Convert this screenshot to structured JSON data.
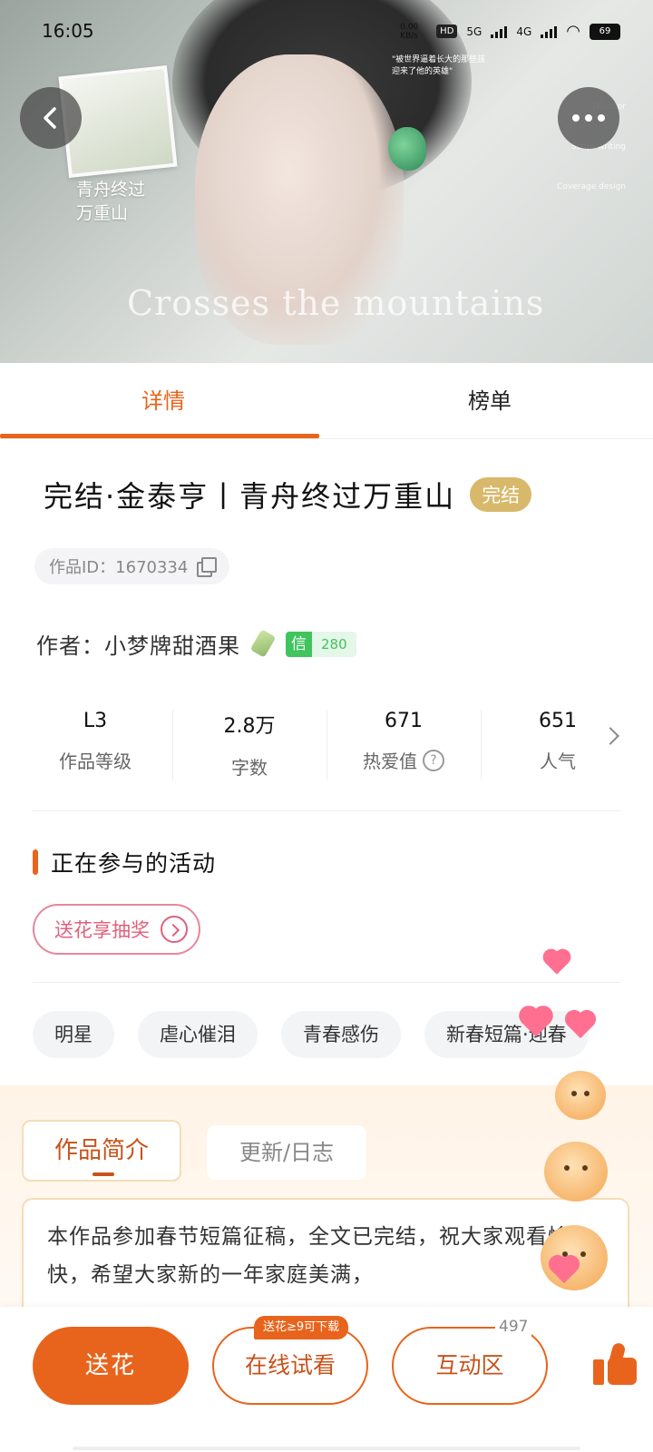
{
  "status_bar": {
    "time": "16:05",
    "net_speed": "0.00 KB/s",
    "hd": "HD",
    "sim1": "5G",
    "sim2": "4G",
    "battery": "69"
  },
  "hero": {
    "poem_line1": "青舟终过",
    "poem_line2": "万重山",
    "art_text": "Crosses the mountains",
    "quote_line1": "\"被世界逼着长大的那些孩",
    "quote_line2": "迎来了他的英雄\"",
    "side_1": "Director",
    "side_2": "Script writing",
    "side_3": "Coverage design"
  },
  "tabs": {
    "detail": "详情",
    "rank": "榜单"
  },
  "work": {
    "title": "完结·金泰亨丨青舟终过万重山",
    "status_badge": "完结",
    "id_text": "作品ID：1670334",
    "author_text": "作者：小梦牌甜酒果",
    "credit_key": "信",
    "credit_value": "280"
  },
  "stats": [
    {
      "value": "L3",
      "label": "作品等级"
    },
    {
      "value": "2.8万",
      "label": "字数"
    },
    {
      "value": "671",
      "label": "热爱值"
    },
    {
      "value": "651",
      "label": "人气"
    }
  ],
  "activities": {
    "heading": "正在参与的活动",
    "pill": "送花享抽奖"
  },
  "tags": [
    "明星",
    "虐心催泪",
    "青春感伤",
    "新春短篇·迎春"
  ],
  "intro": {
    "tab_intro": "作品简介",
    "tab_log": "更新/日志",
    "text": "本作品参加春节短篇征稿，全文已完结，祝大家观看愉快，希望大家新的一年家庭美满，"
  },
  "bottom": {
    "flower": "送花",
    "read_online": "在线试看",
    "read_tip": "送花≥9可下载",
    "interact": "互动区",
    "interact_count": "497"
  },
  "colors": {
    "accent": "#e8641c",
    "done_badge": "#d8b86a",
    "credit_green": "#3fc45e",
    "activity_pink": "#e0607c"
  }
}
